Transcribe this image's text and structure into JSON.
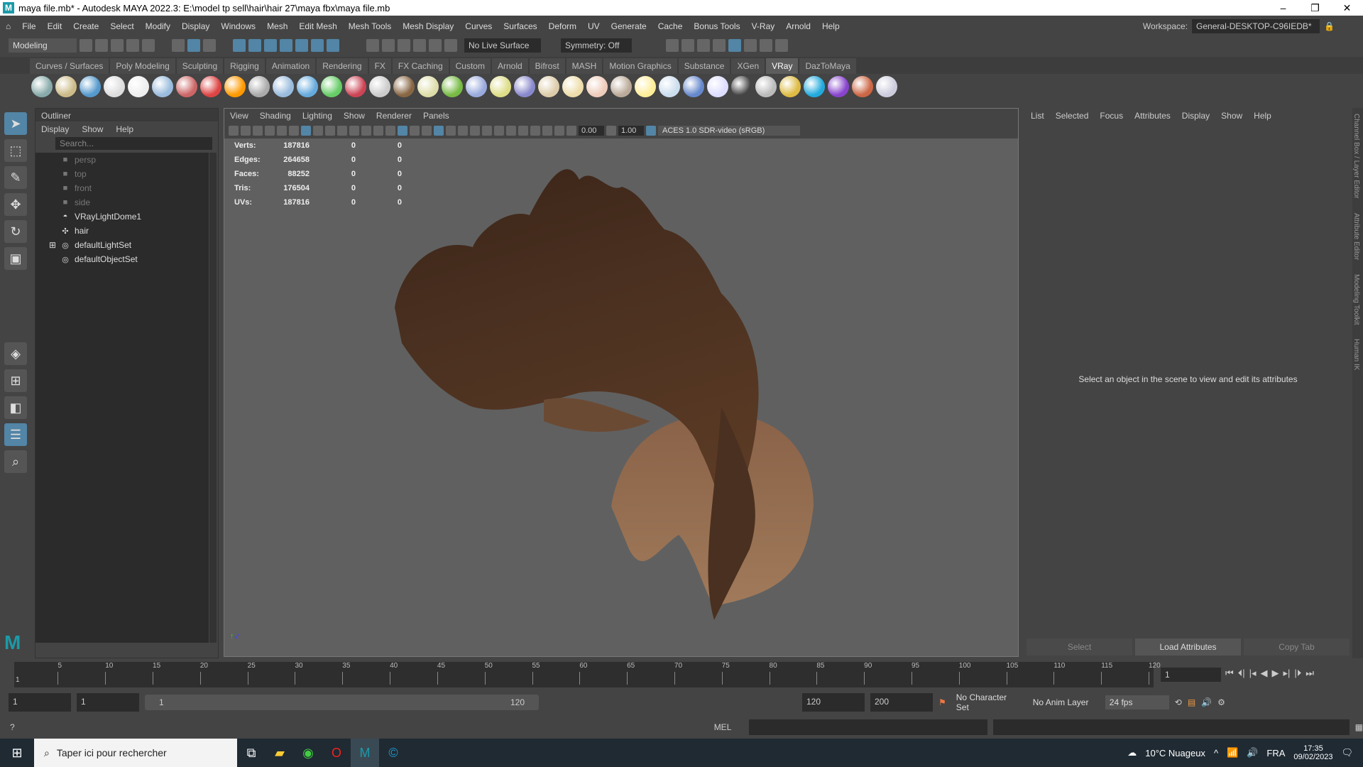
{
  "title": "maya file.mb* - Autodesk MAYA 2022.3: E:\\model tp sell\\hair\\hair 27\\maya fbx\\maya file.mb",
  "menu": [
    "File",
    "Edit",
    "Create",
    "Select",
    "Modify",
    "Display",
    "Windows",
    "Mesh",
    "Edit Mesh",
    "Mesh Tools",
    "Mesh Display",
    "Curves",
    "Surfaces",
    "Deform",
    "UV",
    "Generate",
    "Cache",
    "Bonus Tools",
    "V-Ray",
    "Arnold",
    "Help"
  ],
  "workspace": {
    "label": "Workspace:",
    "value": "General-DESKTOP-C96IEDB*"
  },
  "status": {
    "mode": "Modeling",
    "live": "No Live Surface",
    "symmetry": "Symmetry: Off"
  },
  "shelf_tabs": [
    "Curves / Surfaces",
    "Poly Modeling",
    "Sculpting",
    "Rigging",
    "Animation",
    "Rendering",
    "FX",
    "FX Caching",
    "Custom",
    "Arnold",
    "Bifrost",
    "MASH",
    "Motion Graphics",
    "Substance",
    "XGen",
    "VRay",
    "DazToMaya"
  ],
  "active_shelf": "VRay",
  "shelf_icon_colors": [
    "#8aa",
    "#cb8",
    "#59c",
    "#ddd",
    "#eee",
    "#9bd",
    "#c66",
    "#d44",
    "#f90",
    "#aaa",
    "#9bd",
    "#6ad",
    "#6c6",
    "#c45",
    "#ccc",
    "#864",
    "#dda",
    "#7b4",
    "#9ad",
    "#dd8",
    "#88c",
    "#dca",
    "#eda",
    "#ecb",
    "#ba9",
    "#fe9",
    "#cde",
    "#68c",
    "#ddf",
    "#444",
    "#bbb",
    "#db4",
    "#2ad",
    "#84c",
    "#c64",
    "#ccd"
  ],
  "outliner": {
    "title": "Outliner",
    "menu": [
      "Display",
      "Show",
      "Help"
    ],
    "search_placeholder": "Search...",
    "items": [
      {
        "label": "persp",
        "icon": "camera-icon",
        "dim": true
      },
      {
        "label": "top",
        "icon": "camera-icon",
        "dim": true
      },
      {
        "label": "front",
        "icon": "camera-icon",
        "dim": true
      },
      {
        "label": "side",
        "icon": "camera-icon",
        "dim": true
      },
      {
        "label": "VRayLightDome1",
        "icon": "dome-light-icon",
        "dim": false
      },
      {
        "label": "hair",
        "icon": "transform-icon",
        "dim": false
      },
      {
        "label": "defaultLightSet",
        "icon": "set-icon",
        "dim": false,
        "expand": true
      },
      {
        "label": "defaultObjectSet",
        "icon": "set-icon",
        "dim": false
      }
    ]
  },
  "viewport": {
    "menu": [
      "View",
      "Shading",
      "Lighting",
      "Show",
      "Renderer",
      "Panels"
    ],
    "exposure": "0.00",
    "gamma": "1.00",
    "colorspace": "ACES 1.0 SDR-video (sRGB)",
    "hud": [
      {
        "label": "Verts:",
        "a": "187816",
        "b": "0",
        "c": "0"
      },
      {
        "label": "Edges:",
        "a": "264658",
        "b": "0",
        "c": "0"
      },
      {
        "label": "Faces:",
        "a": "88252",
        "b": "0",
        "c": "0"
      },
      {
        "label": "Tris:",
        "a": "176504",
        "b": "0",
        "c": "0"
      },
      {
        "label": "UVs:",
        "a": "187816",
        "b": "0",
        "c": "0"
      }
    ]
  },
  "attr": {
    "menu": [
      "List",
      "Selected",
      "Focus",
      "Attributes",
      "Display",
      "Show",
      "Help"
    ],
    "message": "Select an object in the scene to view and edit its attributes",
    "buttons": [
      "Select",
      "Load Attributes",
      "Copy Tab"
    ]
  },
  "right_tabs": [
    "Channel Box / Layer Editor",
    "Attribute Editor",
    "Modeling Toolkit",
    "Human IK"
  ],
  "timeline": {
    "ticks": [
      "5",
      "10",
      "15",
      "20",
      "25",
      "30",
      "35",
      "40",
      "45",
      "50",
      "55",
      "60",
      "65",
      "70",
      "75",
      "80",
      "85",
      "90",
      "95",
      "100",
      "105",
      "110",
      "115",
      "120"
    ],
    "start": "1",
    "current": "1"
  },
  "range": {
    "start": "1",
    "inner_start": "1",
    "slider_start": "1",
    "slider_end": "120",
    "end": "120",
    "max": "200",
    "character": "No Character Set",
    "anim_layer": "No Anim Layer",
    "fps": "24 fps"
  },
  "cmd": {
    "lang": "MEL"
  },
  "taskbar": {
    "search": "Taper ici pour rechercher",
    "weather": "10°C  Nuageux",
    "lang": "FRA",
    "time": "17:35",
    "date": "09/02/2023"
  }
}
